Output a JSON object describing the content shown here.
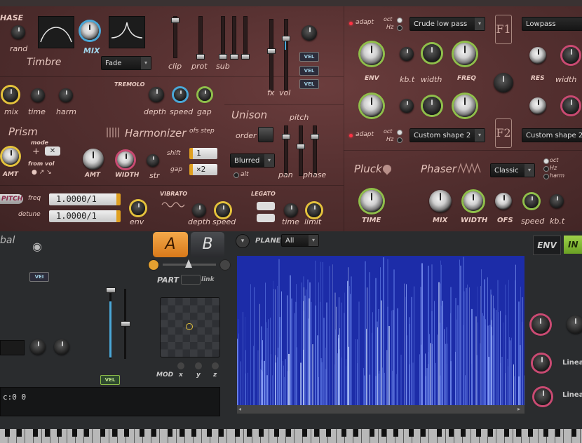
{
  "timbre": {
    "phase_label": "HASE",
    "rand_label": "rand",
    "mix_label": "MIX",
    "title": "Timbre",
    "mode_value": "Fade",
    "mix2_label": "mix",
    "time_label": "time",
    "harm_label": "harm"
  },
  "tremolo": {
    "title": "TREMOLO",
    "depth_label": "depth",
    "speed_label": "speed",
    "gap_label": "gap"
  },
  "faders": {
    "clip": "clip",
    "prot": "prot",
    "sub": "sub",
    "fx": "fx",
    "vol": "vol",
    "vel": [
      "VEL",
      "VEL",
      "VEL"
    ]
  },
  "unison": {
    "title": "Unison",
    "order_label": "order",
    "pitch_label": "pitch",
    "mode_value": "Blurred",
    "alt_label": "alt",
    "pan_label": "pan",
    "phase_label": "phase"
  },
  "prism": {
    "title": "Prism",
    "mode_label": "mode",
    "from_vol_label": "from vol",
    "amt_label": "AMT"
  },
  "harmonizer": {
    "title": "Harmonizer",
    "ofs_step_label": "ofs step",
    "amt_label": "AMT",
    "width_label": "WIDTH",
    "str_label": "str",
    "shift_label": "shift",
    "shift_value": "1",
    "gap_label": "gap",
    "gap_value": "×2"
  },
  "pitch_section": {
    "badge": "PITCH",
    "freq_label": "freq",
    "freq_value": "1.0000/1",
    "detune_label": "detune",
    "detune_value": "1.0000/1",
    "env_label": "env"
  },
  "vibrato": {
    "title": "VIBRATO",
    "depth_label": "depth",
    "speed_label": "speed"
  },
  "legato": {
    "title": "LEGATO",
    "time_label": "time",
    "limit_label": "limit"
  },
  "filter1": {
    "adapt_label": "adapt",
    "oct_label": "oct",
    "hz_label": "Hz",
    "shape_value": "Crude low pass",
    "type_value": "Lowpass",
    "env_label": "ENV",
    "kbt_label": "kb.t",
    "width_label": "width",
    "freq_label": "FREQ",
    "res_label": "RES",
    "width2_label": "width",
    "badge": "F1"
  },
  "filter2": {
    "adapt_label": "adapt",
    "oct_label": "oct",
    "hz_label": "Hz",
    "shape_value": "Custom shape 2",
    "type_value": "Custom shape 2",
    "badge": "F2"
  },
  "pluck": {
    "title": "Pluck",
    "time_label": "TIME"
  },
  "phaser": {
    "title": "Phaser",
    "mode_value": "Classic",
    "oct_label": "oct",
    "hz_label": "Hz",
    "harm_label": "harm",
    "mix_label": "MIX",
    "width_label": "WIDTH",
    "ofs_label": "OFS",
    "speed_label": "speed",
    "kbt_label": "kb.t"
  },
  "bottom": {
    "global_label": "bal",
    "vel_small": "VEI",
    "vel_badge": "VEL",
    "tab_a": "A",
    "tab_b": "B",
    "part_label": "PART",
    "link_label": "link",
    "mod_label": "MOD",
    "x_label": "x",
    "y_label": "y",
    "z_label": "z",
    "plane_label": "PLANE",
    "plane_value": "All",
    "env_tab": "ENV",
    "in_tab": "IN",
    "linear1": "Linea",
    "linear2": "Linea",
    "readout": "c:0 0"
  },
  "colors": {
    "accent_orange": "#f08a22",
    "ring_green": "#8fbf4a",
    "ring_yellow": "#e4c23c",
    "ring_pink": "#c94a72",
    "spectrogram": "#1c2ca8"
  }
}
